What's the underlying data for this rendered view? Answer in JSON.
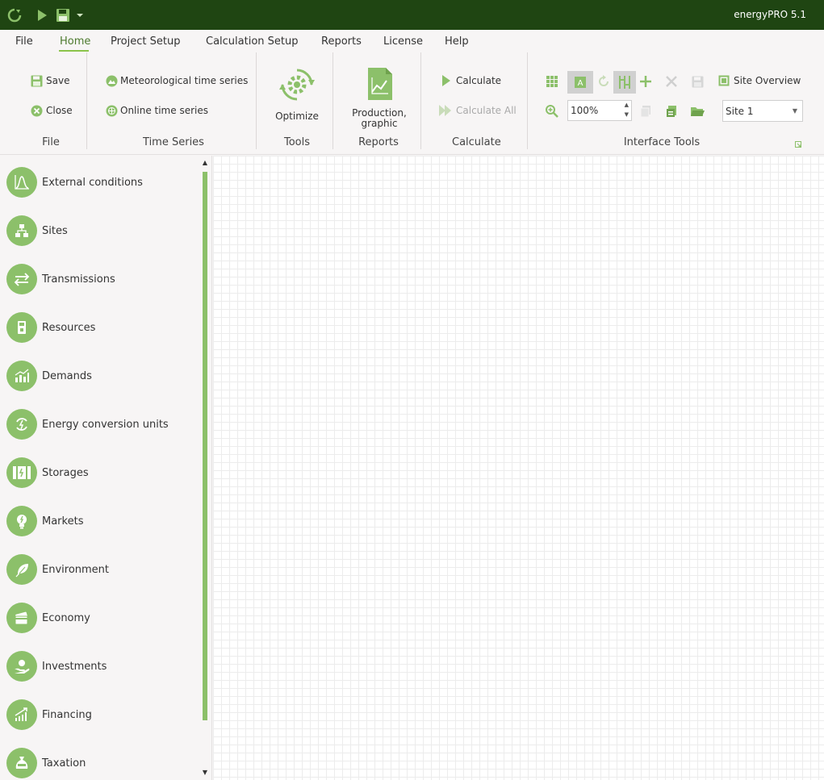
{
  "window": {
    "title": "energyPRO 5.1"
  },
  "menu": {
    "items": [
      {
        "label": "File"
      },
      {
        "label": "Home"
      },
      {
        "label": "Project Setup"
      },
      {
        "label": "Calculation Setup"
      },
      {
        "label": "Reports"
      },
      {
        "label": "License"
      },
      {
        "label": "Help"
      }
    ],
    "active": "Home"
  },
  "ribbon": {
    "file": {
      "save": "Save",
      "close": "Close",
      "label": "File"
    },
    "time_series": {
      "meteorological": "Meteorological time series",
      "online": "Online time series",
      "label": "Time Series"
    },
    "tools": {
      "optimize": "Optimize",
      "label": "Tools"
    },
    "reports": {
      "production_line1": "Production,",
      "production_line2": "graphic",
      "label": "Reports"
    },
    "calculate": {
      "calculate": "Calculate",
      "calculate_all": "Calculate All",
      "label": "Calculate"
    },
    "interface_tools": {
      "site_overview": "Site Overview",
      "zoom": "100%",
      "site": "Site 1",
      "label": "Interface Tools"
    }
  },
  "sidebar": {
    "items": [
      {
        "label": "External conditions",
        "icon": "chart-curve-icon"
      },
      {
        "label": "Sites",
        "icon": "sitemap-icon"
      },
      {
        "label": "Transmissions",
        "icon": "arrows-icon"
      },
      {
        "label": "Resources",
        "icon": "fuel-icon"
      },
      {
        "label": "Demands",
        "icon": "bar-chart-icon"
      },
      {
        "label": "Energy conversion units",
        "icon": "conversion-icon"
      },
      {
        "label": "Storages",
        "icon": "battery-icon"
      },
      {
        "label": "Markets",
        "icon": "bulb-icon"
      },
      {
        "label": "Environment",
        "icon": "leaf-icon"
      },
      {
        "label": "Economy",
        "icon": "card-icon"
      },
      {
        "label": "Investments",
        "icon": "hand-coin-icon"
      },
      {
        "label": "Financing",
        "icon": "growth-icon"
      },
      {
        "label": "Taxation",
        "icon": "tax-bag-icon"
      }
    ]
  },
  "colors": {
    "titlebar": "#1f4512",
    "accent": "#8cc06a",
    "active_menu": "#4d7a2e"
  }
}
